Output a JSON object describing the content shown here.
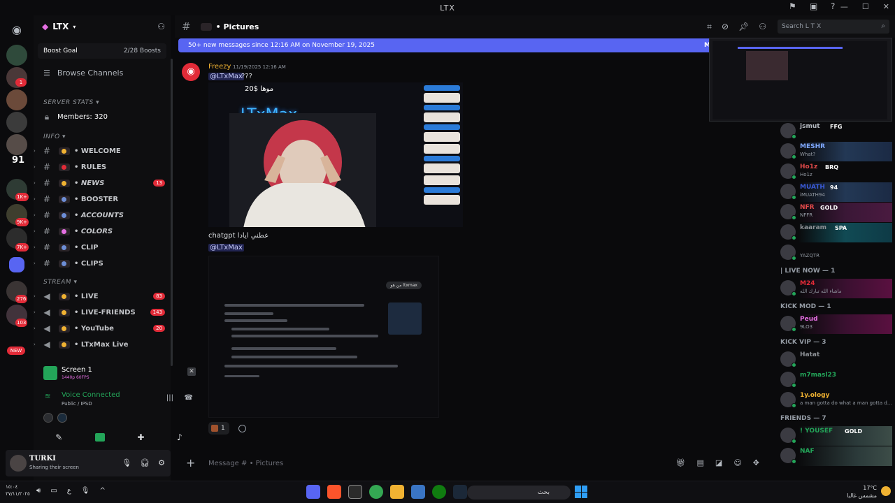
{
  "window": {
    "title": "LTX"
  },
  "server": {
    "name": "LTX",
    "boost_goal": "Boost Goal",
    "boost_count": "2/28 Boosts",
    "browse_channels": "Browse Channels"
  },
  "rail": {
    "number_badge": "91",
    "badges": [
      "1",
      "1K+",
      "9K+",
      "7K+",
      "276",
      "103",
      "NEW"
    ]
  },
  "categories": {
    "server_stats": "SERVER STATS",
    "info": "INFO",
    "stream": "STREAM"
  },
  "members_channel": "Members: 320",
  "channels_info": [
    {
      "label": "• WELCOME",
      "italic": false,
      "count": ""
    },
    {
      "label": "• RULES",
      "italic": false,
      "count": ""
    },
    {
      "label": "• NEWS",
      "italic": true,
      "count": "13"
    },
    {
      "label": "• BOOSTER",
      "italic": false,
      "count": ""
    },
    {
      "label": "• ACCOUNTS",
      "italic": true,
      "count": ""
    },
    {
      "label": "• COLORS",
      "italic": true,
      "count": ""
    },
    {
      "label": "• CLIP",
      "italic": false,
      "count": ""
    },
    {
      "label": "• CLIPS",
      "italic": false,
      "count": ""
    }
  ],
  "channels_stream": [
    {
      "label": "• LIVE",
      "count": "83"
    },
    {
      "label": "• LIVE-FRIENDS",
      "count": "143"
    },
    {
      "label": "• YouTube",
      "count": "20"
    },
    {
      "label": "• LTxMax Live",
      "count": ""
    }
  ],
  "screen_share": {
    "title": "Screen 1",
    "sub": "1440p 60FPS"
  },
  "voice": {
    "status": "Voice Connected",
    "channel": "Public / IPSD"
  },
  "user": {
    "name": "TURKI",
    "status": "Sharing their screen"
  },
  "header": {
    "channel": "• Pictures",
    "search_placeholder": "Search L T X"
  },
  "new_messages": {
    "text": "50+ new messages since 12:16 AM on November 19, 2025",
    "mark": "M"
  },
  "message": {
    "author": "Freezy",
    "time": "11/19/2025 12:16 AM",
    "mention": "@LTxMax",
    "mention_suffix": "???",
    "image_price": "20$ موها",
    "image_neon": "LTxMax",
    "arabic_text": "chatgpt عطني ايادا",
    "mention2": "@LTxMax",
    "doc_pill": "من هو ltxmax",
    "reaction_count": "1"
  },
  "composer": {
    "placeholder": "Message # • Pictures"
  },
  "member_list": {
    "top": [
      {
        "name": "jsmut",
        "tag": "FFG",
        "sub": "",
        "color": "#b5bac1",
        "style": ""
      },
      {
        "name": "MESHR",
        "tag": "",
        "sub": "What?",
        "color": "#7fa8ff",
        "style": "banner"
      },
      {
        "name": "Ho1z",
        "tag": "BRQ",
        "sub": "Ho1z",
        "color": "#e24a4a",
        "style": ""
      },
      {
        "name": "MUATH",
        "tag": "94",
        "sub": "iMUATH94",
        "color": "#3a5bd9",
        "style": "banner"
      },
      {
        "name": "NFR",
        "tag": "GOLD",
        "sub": "NFFR",
        "color": "#e24a4a",
        "style": "banner2"
      },
      {
        "name": "kaaram",
        "tag": "SPA",
        "sub": "",
        "color": "#8e9297",
        "style": "banner3"
      },
      {
        "name": "",
        "tag": "",
        "sub": "YAZQTR",
        "color": "#8e9297",
        "style": ""
      }
    ],
    "live_now_header": "| LIVE NOW — 1",
    "live_now": [
      {
        "name": "M24",
        "sub": "ماشاء الله تبارك الله",
        "color": "#e22b38"
      }
    ],
    "kick_mod_header": "KICK MOD — 1",
    "kick_mod": [
      {
        "name": "Peud",
        "sub": "9LO3",
        "color": "#e56fe2"
      }
    ],
    "kick_vip_header": "KICK VIP — 3",
    "kick_vip": [
      {
        "name": "Hatat",
        "sub": "",
        "color": "#8e9297"
      },
      {
        "name": "m7masl23",
        "sub": "",
        "color": "#23a559"
      },
      {
        "name": "1y.ology",
        "sub": "a man gotta do what a man gotta d...",
        "color": "#f0b232"
      }
    ],
    "friends_header": "FRIENDS — 7",
    "friends": [
      {
        "name": "! YOUSEF",
        "tag": "GOLD",
        "color": "#23a559"
      },
      {
        "name": "NAF",
        "tag": "",
        "color": "#23a559"
      }
    ]
  },
  "taskbar": {
    "time": "١٥:٠٤",
    "date": "٢٧/١١/٢٠٢٥",
    "search": "بحث",
    "temp": "17°C",
    "weather": "مشمس غالبا"
  }
}
